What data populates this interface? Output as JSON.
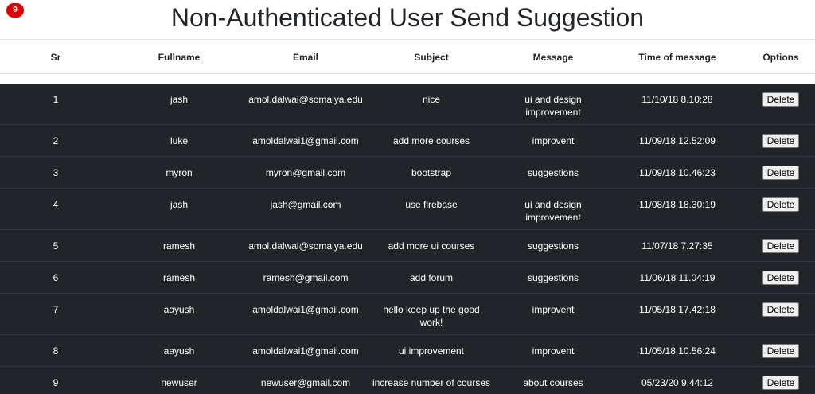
{
  "badge": {
    "count": "9"
  },
  "title": "Non-Authenticated User Send Suggestion",
  "columns": [
    "Sr",
    "Fullname",
    "Email",
    "Subject",
    "Message",
    "Time of message",
    "Options"
  ],
  "delete_label": "Delete",
  "rows": [
    {
      "sr": "1",
      "fullname": "jash",
      "email": "amol.dalwai@somaiya.edu",
      "subject": "nice",
      "message": "ui and design improvement",
      "time": "11/10/18 8.10:28"
    },
    {
      "sr": "2",
      "fullname": "luke",
      "email": "amoldalwai1@gmail.com",
      "subject": "add more courses",
      "message": "improvent",
      "time": "11/09/18 12.52:09"
    },
    {
      "sr": "3",
      "fullname": "myron",
      "email": "myron@gmail.com",
      "subject": "bootstrap",
      "message": "suggestions",
      "time": "11/09/18 10.46:23"
    },
    {
      "sr": "4",
      "fullname": "jash",
      "email": "jash@gmail.com",
      "subject": "use firebase",
      "message": "ui and design improvement",
      "time": "11/08/18 18.30:19"
    },
    {
      "sr": "5",
      "fullname": "ramesh",
      "email": "amol.dalwai@somaiya.edu",
      "subject": "add more ui courses",
      "message": "suggestions",
      "time": "11/07/18 7.27:35"
    },
    {
      "sr": "6",
      "fullname": "ramesh",
      "email": "ramesh@gmail.com",
      "subject": "add forum",
      "message": "suggestions",
      "time": "11/06/18 11.04:19"
    },
    {
      "sr": "7",
      "fullname": "aayush",
      "email": "amoldalwai1@gmail.com",
      "subject": "hello keep up the good work!",
      "message": "improvent",
      "time": "11/05/18 17.42:18"
    },
    {
      "sr": "8",
      "fullname": "aayush",
      "email": "amoldalwai1@gmail.com",
      "subject": "ui improvement",
      "message": "improvent",
      "time": "11/05/18 10.56:24"
    },
    {
      "sr": "9",
      "fullname": "newuser",
      "email": "newuser@gmail.com",
      "subject": "increase number of courses",
      "message": "about courses",
      "time": "05/23/20 9.44:12"
    }
  ]
}
